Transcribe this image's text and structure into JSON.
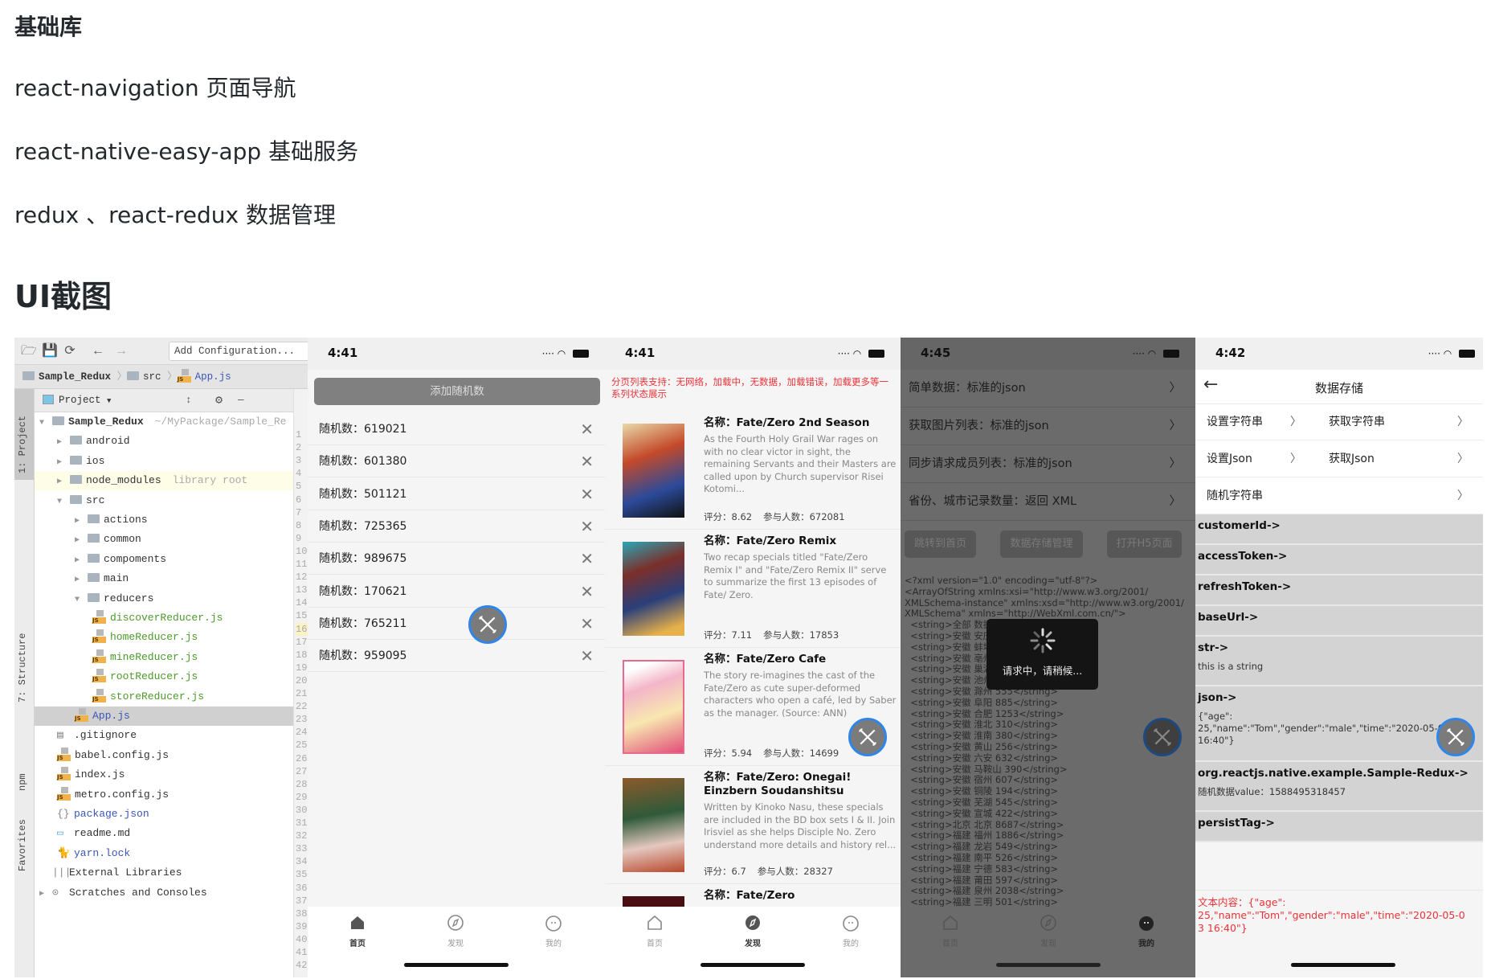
{
  "doc": {
    "heading_libs": "基础库",
    "lib_lines": [
      "react-navigation 页面导航",
      "react-native-easy-app 基础服务",
      "redux 、react-redux 数据管理"
    ],
    "heading_ui": "UI截图"
  },
  "ide": {
    "add_configuration": "Add Configuration...",
    "breadcrumb": [
      "Sample_Redux",
      "src",
      "App.js"
    ],
    "project_label": "Project",
    "side_tools": [
      "1: Project",
      "7: Structure",
      "npm",
      "Favorites"
    ],
    "tree": [
      {
        "label": "Sample_Redux",
        "hint": "~/MyPackage/Sample_Re",
        "type": "folder",
        "level": 0,
        "open": true,
        "bold": true
      },
      {
        "label": "android",
        "type": "folder",
        "level": 1
      },
      {
        "label": "ios",
        "type": "folder",
        "level": 1
      },
      {
        "label": "node_modules",
        "hint": "library root",
        "type": "folder",
        "level": 1,
        "highlight": "#fdfde8"
      },
      {
        "label": "src",
        "type": "folder",
        "level": 1,
        "open": true
      },
      {
        "label": "actions",
        "type": "folder",
        "level": 2
      },
      {
        "label": "common",
        "type": "folder",
        "level": 2
      },
      {
        "label": "compoments",
        "type": "folder",
        "level": 2
      },
      {
        "label": "main",
        "type": "folder",
        "level": 2
      },
      {
        "label": "reducers",
        "type": "folder",
        "level": 2,
        "open": true
      },
      {
        "label": "discoverReducer.js",
        "type": "js",
        "level": 3,
        "color": "#4c9a2a"
      },
      {
        "label": "homeReducer.js",
        "type": "js",
        "level": 3,
        "color": "#4c9a2a"
      },
      {
        "label": "mineReducer.js",
        "type": "js",
        "level": 3,
        "color": "#4c9a2a"
      },
      {
        "label": "rootReducer.js",
        "type": "js",
        "level": 3,
        "color": "#4c9a2a"
      },
      {
        "label": "storeReducer.js",
        "type": "js",
        "level": 3,
        "color": "#4c9a2a"
      },
      {
        "label": "App.js",
        "type": "js",
        "level": 2,
        "color": "#3b55b8",
        "selected": true
      },
      {
        "label": ".gitignore",
        "type": "text",
        "level": 1
      },
      {
        "label": "babel.config.js",
        "type": "js",
        "level": 1
      },
      {
        "label": "index.js",
        "type": "js",
        "level": 1
      },
      {
        "label": "metro.config.js",
        "type": "js",
        "level": 1
      },
      {
        "label": "package.json",
        "type": "json",
        "level": 1,
        "color": "#3b55b8"
      },
      {
        "label": "readme.md",
        "type": "md",
        "level": 1
      },
      {
        "label": "yarn.lock",
        "type": "yarn",
        "level": 1,
        "color": "#3b55b8"
      },
      {
        "label": "External Libraries",
        "type": "lib",
        "level": 0
      },
      {
        "label": "Scratches and Consoles",
        "type": "scratch",
        "level": 0,
        "closed": true
      }
    ],
    "line_numbers": [
      "1",
      "2",
      "3",
      "4",
      "5",
      "6",
      "7",
      "8",
      "9",
      "10",
      "11",
      "12",
      "13",
      "14",
      "15",
      "16",
      "17",
      "18",
      "19",
      "20",
      "21",
      "22",
      "23",
      "24",
      "25",
      "26",
      "27",
      "28",
      "29",
      "30",
      "31",
      "32",
      "33",
      "34",
      "35",
      "36",
      "37",
      "38",
      "39",
      "40",
      "41",
      "42"
    ]
  },
  "tabs": [
    "首页",
    "发现",
    "我的"
  ],
  "phone1": {
    "time": "4:41",
    "add_button": "添加随机数",
    "rows": [
      "随机数：619021",
      "随机数：601380",
      "随机数：501121",
      "随机数：725365",
      "随机数：989675",
      "随机数：170621",
      "随机数：765211",
      "随机数：959095"
    ],
    "active_tab": 0
  },
  "phone2": {
    "time": "4:41",
    "notice": "分页列表支持：无网络，加载中，无数据，加载错误，加载更多等一系列状态展示",
    "notice_color": "#e8333a",
    "items": [
      {
        "title": "名称：Fate/Zero 2nd Season",
        "desc": "As the Fourth Holy Grail War rages on with no clear victor in sight, the remaining Servants and their Masters are called upon by Church supervisor Risei Kotomi...",
        "rating": "评分：8.62",
        "count": "参与人数：672081"
      },
      {
        "title": "名称：Fate/Zero Remix",
        "desc": "Two recap specials titled \"Fate/Zero Remix I\" and \"Fate/Zero Remix II\" serve to summarize the first 13 episodes of Fate/ Zero.",
        "rating": "评分：7.11",
        "count": "参与人数：17853"
      },
      {
        "title": "名称：Fate/Zero Cafe",
        "desc": "The story re-imagines the cast of the Fate/Zero as cute super-deformed characters who open a café, led by Saber as the manager. (Source: ANN)",
        "rating": "评分：5.94",
        "count": "参与人数：14699"
      },
      {
        "title": "名称：Fate/Zero: Onegai! Einzbern Soudanshitsu",
        "desc": "Written by Kinoko Nasu, these specials are included in the BD box sets I & II. Join Irisviel as she helps Disciple No. Zero understand more details and history rel...",
        "rating": "评分：6.7",
        "count": "参与人数：28327"
      },
      {
        "title": "名称：Fate/Zero",
        "desc": "",
        "rating": "",
        "count": ""
      }
    ],
    "active_tab": 1
  },
  "phone3": {
    "time": "4:45",
    "rows": [
      "简单数据：标准的json",
      "获取图片列表：标准的json",
      "同步请求成员列表：标准的json",
      "省份、城市记录数量：返回 XML"
    ],
    "buttons": [
      "跳转到首页",
      "数据存储管理",
      "打开H5页面"
    ],
    "xml_lines": [
      "<?xml version=\"1.0\" encoding=\"utf-8\"?>",
      "<ArrayOfString xmlns:xsi=\"http://www.w3.org/2001/",
      "XMLSchema-instance\" xmlns:xsd=\"http://www.w3.org/2001/",
      "XMLSchema\" xmlns=\"http://WebXml.com.cn/\">",
      "  <string>全部 数据",
      "  <string>安徽 安庆",
      "  <string>安徽 蚌埠",
      "  <string>安徽 亳州",
      "  <string>安徽 巢湖",
      "  <string>安徽 池州",
      "  <string>安徽 滁州 555</string>",
      "  <string>安徽 阜阳 885</string>",
      "  <string>安徽 合肥 1253</string>",
      "  <string>安徽 淮北 310</string>",
      "  <string>安徽 淮南 380</string>",
      "  <string>安徽 黄山 256</string>",
      "  <string>安徽 六安 632</string>",
      "  <string>安徽 马鞍山 390</string>",
      "  <string>安徽 宿州 607</string>",
      "  <string>安徽 铜陵 194</string>",
      "  <string>安徽 芜湖 545</string>",
      "  <string>安徽 宣城 422</string>",
      "  <string>北京 北京 8687</string>",
      "  <string>福建 福州 1886</string>",
      "  <string>福建 龙岩 549</string>",
      "  <string>福建 南平 526</string>",
      "  <string>福建 宁德 583</string>",
      "  <string>福建 莆田 597</string>",
      "  <string>福建 泉州 2038</string>",
      "  <string>福建 三明 501</string>"
    ],
    "toast": "请求中，请稍候...",
    "active_tab": 2
  },
  "phone4": {
    "time": "4:42",
    "title": "数据存储",
    "actions": [
      [
        "设置字符串",
        "获取字符串"
      ],
      [
        "设置Json",
        "获取Json"
      ],
      [
        "随机字符串"
      ]
    ],
    "entries": [
      {
        "key": "customerId->",
        "value": ""
      },
      {
        "key": "accessToken->",
        "value": ""
      },
      {
        "key": "refreshToken->",
        "value": ""
      },
      {
        "key": "baseUrl->",
        "value": ""
      },
      {
        "key": "str->",
        "value": "this is a string"
      },
      {
        "key": "json->",
        "value": "{\"age\":\n25,\"name\":\"Tom\",\"gender\":\"male\",\"time\":\"2020-05-03\n16:40\"}"
      },
      {
        "key": "org.reactjs.native.example.Sample-Redux->",
        "value": "随机数据value：1588495318457"
      },
      {
        "key": "persistTag->",
        "value": ""
      }
    ],
    "result_text": "文本内容：{\"age\":\n25,\"name\":\"Tom\",\"gender\":\"male\",\"time\":\"2020-05-0\n3 16:40\"}",
    "result_color": "#e8333a"
  }
}
